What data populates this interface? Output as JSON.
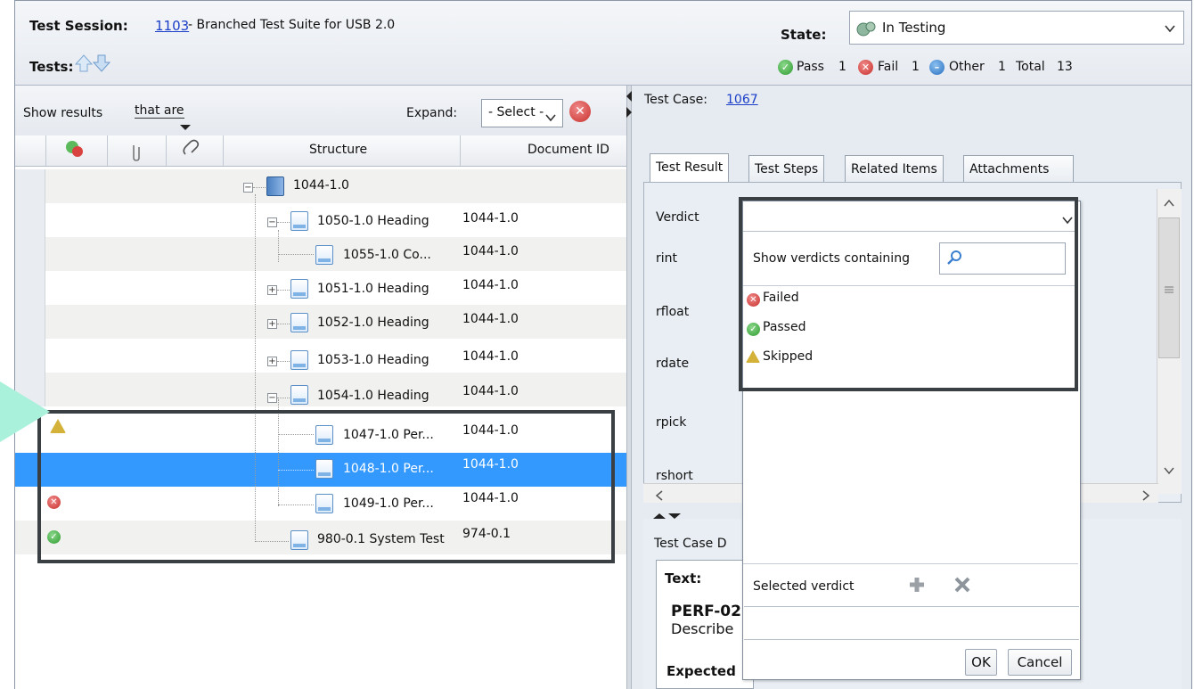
{
  "session": {
    "label": "Test Session:",
    "id": "1103",
    "title": "- Branched Test Suite for USB 2.0",
    "tests_label": "Tests:"
  },
  "state": {
    "label": "State:",
    "value": "In Testing"
  },
  "counts": {
    "pass_label": "Pass",
    "pass": "1",
    "fail_label": "Fail",
    "fail": "1",
    "other_label": "Other",
    "other": "1",
    "total_label": "Total",
    "total": "13"
  },
  "filter": {
    "show_label": "Show results",
    "qualifier": "that are",
    "expand_label": "Expand:",
    "expand_value": "- Select -"
  },
  "columns": {
    "structure": "Structure",
    "document_id": "Document ID"
  },
  "rows": [
    {
      "label": "1044-1.0",
      "doc": ""
    },
    {
      "label": "1050-1.0 Heading",
      "doc": "1044-1.0"
    },
    {
      "label": "1055-1.0 Co...",
      "doc": "1044-1.0"
    },
    {
      "label": "1051-1.0 Heading",
      "doc": "1044-1.0"
    },
    {
      "label": "1052-1.0 Heading",
      "doc": "1044-1.0"
    },
    {
      "label": "1053-1.0 Heading",
      "doc": "1044-1.0"
    },
    {
      "label": "1054-1.0 Heading",
      "doc": "1044-1.0"
    },
    {
      "label": "1047-1.0 Per...",
      "doc": "1044-1.0",
      "status": "skipped"
    },
    {
      "label": "1048-1.0 Per...",
      "doc": "1044-1.0",
      "selected": true
    },
    {
      "label": "1049-1.0 Per...",
      "doc": "1044-1.0",
      "status": "failed"
    },
    {
      "label": "980-0.1 System Test",
      "doc": "974-0.1",
      "status": "passed"
    }
  ],
  "testcase": {
    "label": "Test Case:",
    "id": "1067"
  },
  "tabs": [
    "Test Result",
    "Test Steps",
    "Related Items",
    "Attachments"
  ],
  "fields": [
    "Verdict",
    "rint",
    "rfloat",
    "rdate",
    "rpick",
    "rshort"
  ],
  "lower": {
    "title": "Test Case D",
    "text_label": "Text:",
    "heading": "PERF-02",
    "describe": "Describe",
    "expected": "Expected"
  },
  "verdict_popup": {
    "search_label": "Show verdicts containing",
    "options": [
      "Failed",
      "Passed",
      "Skipped"
    ],
    "selected_label": "Selected verdict",
    "ok": "OK",
    "cancel": "Cancel"
  },
  "colors": {
    "selection": "#3399ff",
    "link": "#1a3ec8",
    "highlight_border": "#3a3f44",
    "callout": "#a9f1da"
  }
}
